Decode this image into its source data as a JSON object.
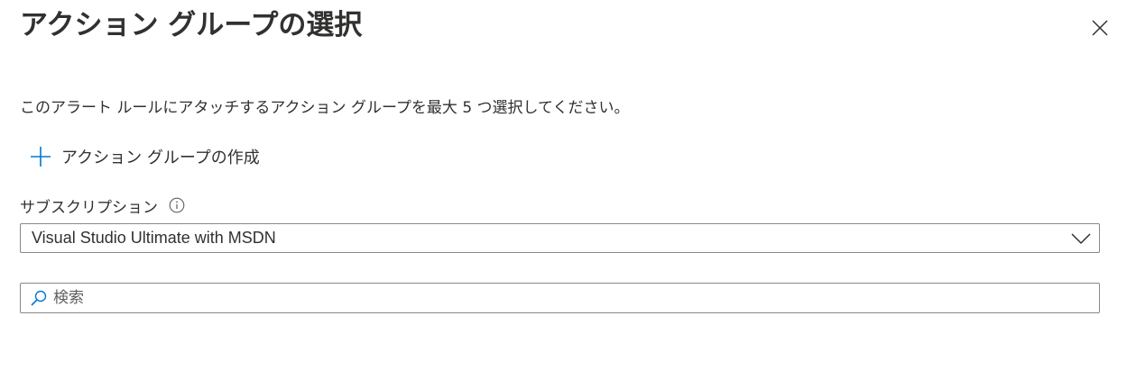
{
  "panel": {
    "title": "アクション グループの選択",
    "close_icon": "close-icon",
    "description": "このアラート ルールにアタッチするアクション グループを最大 5 つ選択してください。"
  },
  "create_action": {
    "icon": "plus-icon",
    "label": "アクション グループの作成",
    "accent_color": "#0078d4"
  },
  "subscription": {
    "label": "サブスクリプション",
    "info_icon": "info-icon",
    "selected_value": "Visual Studio Ultimate with MSDN",
    "chevron_icon": "chevron-down-icon"
  },
  "search": {
    "icon": "search-icon",
    "placeholder": "検索",
    "value": ""
  }
}
